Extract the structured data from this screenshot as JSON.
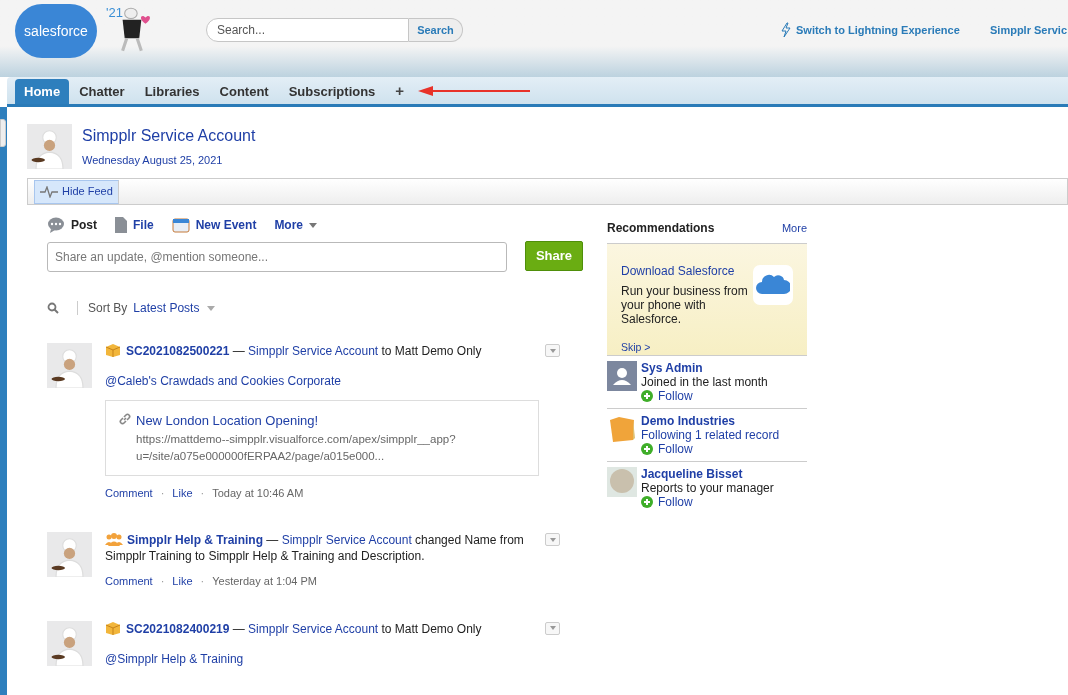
{
  "header": {
    "logo": "salesforce",
    "release": "'21",
    "search": {
      "placeholder": "Search...",
      "button": "Search"
    },
    "links": [
      {
        "label": "Switch to Lightning Experience",
        "kind": "lightning"
      },
      {
        "label": "Simpplr Servic",
        "kind": "plain"
      }
    ]
  },
  "tabs": [
    {
      "label": "Home",
      "selected": true
    },
    {
      "label": "Chatter",
      "selected": false
    },
    {
      "label": "Libraries",
      "selected": false
    },
    {
      "label": "Content",
      "selected": false
    },
    {
      "label": "Subscriptions",
      "selected": false
    }
  ],
  "add_tab": "+",
  "profile": {
    "name": "Simpplr Service Account",
    "date": "Wednesday August 25, 2021"
  },
  "hide_feed": "Hide Feed",
  "publisher": {
    "actions": [
      {
        "label": "Post",
        "kind": "post",
        "selected": true
      },
      {
        "label": "File",
        "kind": "file",
        "selected": false
      },
      {
        "label": "New Event",
        "kind": "event",
        "selected": false
      },
      {
        "label": "More",
        "kind": "more",
        "selected": false
      }
    ],
    "placeholder": "Share an update, @mention someone...",
    "share": "Share"
  },
  "sort": {
    "label": "Sort By",
    "value": "Latest Posts"
  },
  "posts": [
    {
      "kind": "case",
      "title": "SC2021082500221",
      "dash": "—",
      "actor": "Simpplr Service Account",
      "text": "to Matt Demo Only",
      "mention": "@Caleb's Crawdads and Cookies Corporate",
      "link": {
        "title": "New London Location Opening!",
        "url_lines": [
          "https://mattdemo--simpplr.visualforce.com/apex/simpplr__app?",
          "u=/site/a075e000000fERPAA2/page/a015e000..."
        ]
      },
      "actions": [
        "Comment",
        "Like"
      ],
      "separator": "·",
      "time": "Today at 10:46 AM"
    },
    {
      "kind": "group",
      "title": "Simpplr Help & Training",
      "dash": "—",
      "actor": "Simpplr Service Account",
      "text": "changed Name from Simpplr Training to Simpplr Help & Training and Description.",
      "actions": [
        "Comment",
        "Like"
      ],
      "separator": "·",
      "time": "Yesterday at 1:04 PM"
    },
    {
      "kind": "case",
      "title": "SC2021082400219",
      "dash": "—",
      "actor": "Simpplr Service Account",
      "text": "to Matt Demo Only",
      "mention": "@Simpplr Help & Training"
    }
  ],
  "recommendations": {
    "title": "Recommendations",
    "more": "More",
    "promo": {
      "title": "Download Salesforce",
      "body": "Run your business from your phone with Salesforce.",
      "skip": "Skip >"
    },
    "items": [
      {
        "kind": "user",
        "name": "Sys Admin",
        "subtitle": "Joined in the last month",
        "follow": "Follow"
      },
      {
        "kind": "record",
        "name": "Demo Industries",
        "subtitle": "Following 1 related record",
        "follow": "Follow"
      },
      {
        "kind": "person",
        "name": "Jacqueline Bisset",
        "subtitle": "Reports to your manager",
        "follow": "Follow"
      }
    ]
  }
}
